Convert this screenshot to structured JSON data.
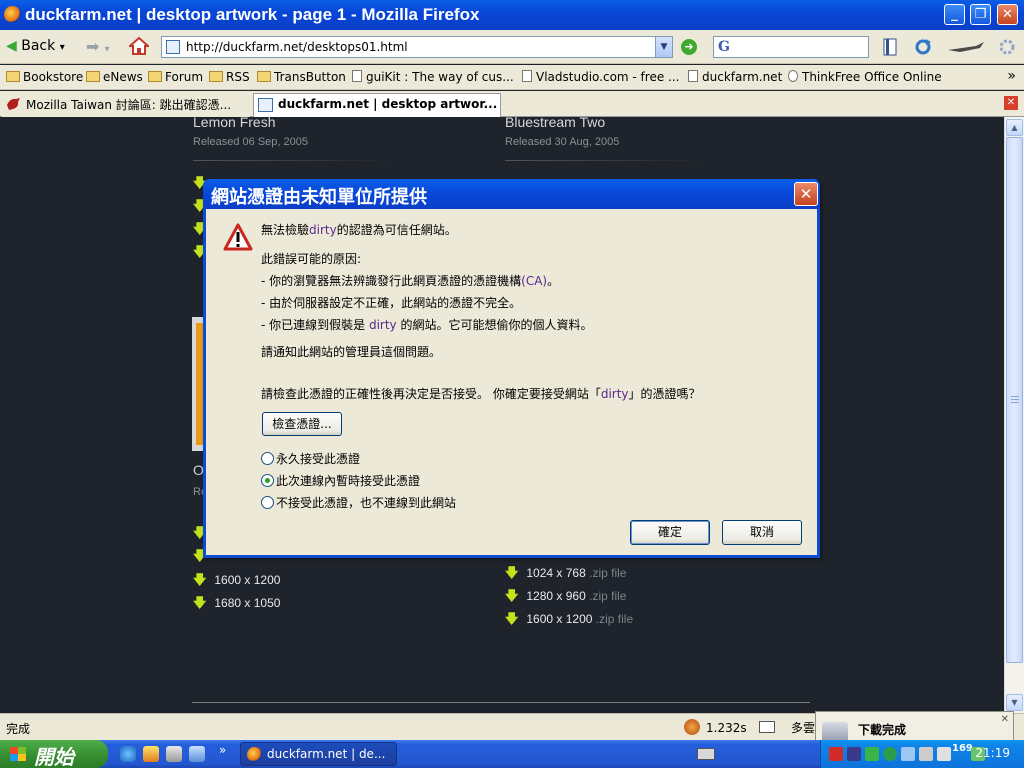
{
  "window": {
    "title": "duckfarm.net | desktop artwork - page 1 - Mozilla Firefox",
    "minimize": "_",
    "maximize": "❐",
    "close": "✕"
  },
  "nav": {
    "back_label": "Back",
    "back_arrow": "◀",
    "back_drop": "▾",
    "forward_arrow": "➡",
    "forward_drop": "▾",
    "url": "http://duckfarm.net/desktops01.html",
    "url_drop": "▼",
    "go": "➜",
    "search_engine": "G"
  },
  "bookmarks": {
    "items": [
      {
        "label": "Bookstore",
        "icon": "folder-icon"
      },
      {
        "label": "eNews",
        "icon": "folder-icon"
      },
      {
        "label": "Forum",
        "icon": "folder-icon"
      },
      {
        "label": "RSS",
        "icon": "folder-icon"
      },
      {
        "label": "TransButton",
        "icon": "folder-icon"
      },
      {
        "label": "guiKit : The way of cus...",
        "icon": "page-icon"
      },
      {
        "label": "Vladstudio.com - free ...",
        "icon": "page-icon"
      },
      {
        "label": "duckfarm.net",
        "icon": "page-icon"
      },
      {
        "label": "ThinkFree Office Online",
        "icon": "page-icon"
      }
    ],
    "more": "»"
  },
  "tabs": [
    {
      "label": "Mozilla Taiwan 討論區: 跳出確認憑...",
      "active": false
    },
    {
      "label": "duckfarm.net | desktop artwor...",
      "active": true
    }
  ],
  "tab_close": "✕",
  "page": {
    "left_art": {
      "name": "Lemon Fresh",
      "date": "Released 06 Sep, 2005"
    },
    "right_art": {
      "name": "Bluestream Two",
      "date": "Released 30 Aug, 2005"
    },
    "frag_o": "O",
    "frag_re": "Re",
    "left_downloads": [
      "1600 x 1200",
      "1680 x 1050"
    ],
    "right_downloads": [
      {
        "res": "1024 x 768",
        "ext": ".zip file"
      },
      {
        "res": "1280 x 960",
        "ext": ".zip file"
      },
      {
        "res": "1600 x 1200",
        "ext": ".zip file"
      }
    ],
    "download_arrow": "🡇"
  },
  "dialog": {
    "title": "網站憑證由未知單位所提供",
    "close": "✕",
    "line1_a": "無法檢驗",
    "line1_site": "dirty",
    "line1_b": "的認證為可信任網站。",
    "reasons_heading": "此錯誤可能的原因:",
    "reason1_a": "- 你的瀏覽器無法辨識發行此網頁憑證的憑證機構",
    "reason1_ca": "(CA)",
    "reason1_b": "。",
    "reason2": "- 由於伺服器設定不正確，此網站的憑證不完全。",
    "reason3_a": "- 你已連線到假裝是 ",
    "reason3_site": "dirty",
    "reason3_b": " 的網站。它可能想偷你的個人資料。",
    "notify": "請通知此網站的管理員這個問題。",
    "question_a": "請檢查此憑證的正確性後再決定是否接受。 你確定要接受網站「",
    "question_site": "dirty",
    "question_b": "」的憑證嗎？",
    "examine_button": "檢查憑證...",
    "options": [
      {
        "label": "永久接受此憑證",
        "selected": false
      },
      {
        "label": "此次連線內暫時接受此憑證",
        "selected": true
      },
      {
        "label": "不接受此憑證，也不連線到此網站",
        "selected": false
      }
    ],
    "ok": "確定",
    "cancel": "取消"
  },
  "status": {
    "text": "完成",
    "timing": "1.232s",
    "more": "多雲"
  },
  "download_popup": {
    "title": "下載完成",
    "close": "✕"
  },
  "taskbar": {
    "start": "開始",
    "quicklaunch_more": "»",
    "task_label": "duckfarm.net | de...",
    "tray_number": "169",
    "clock": "21:19"
  },
  "scrollbar": {
    "up": "▲",
    "down": "▼"
  },
  "colors": {
    "accent": "#0a4cd2",
    "page_bg": "#1f242c",
    "download_arrow": "#c4e21b"
  }
}
